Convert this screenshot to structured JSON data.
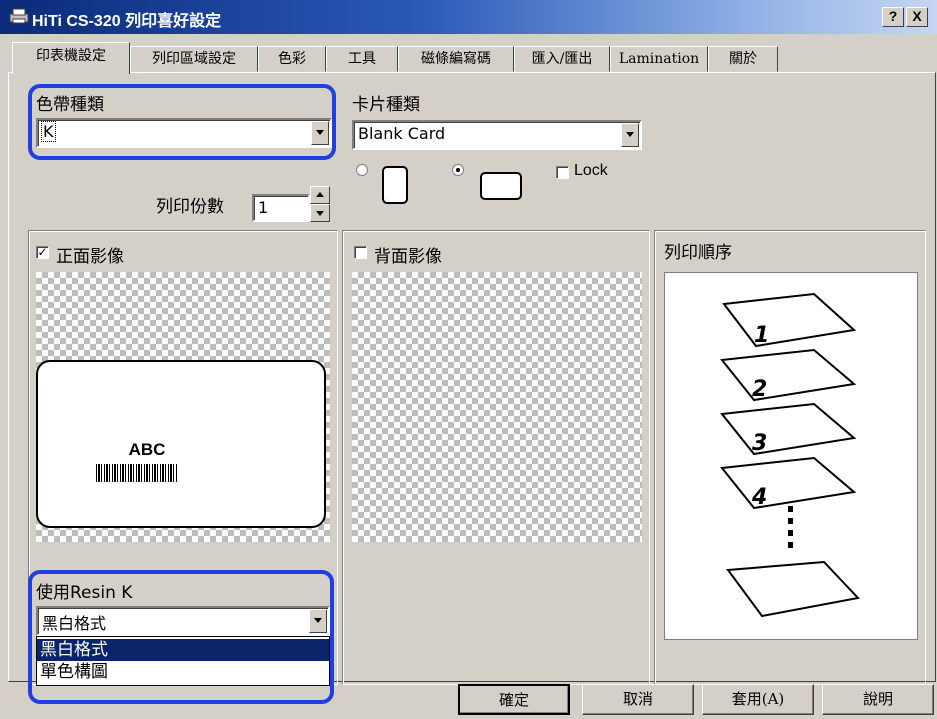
{
  "window": {
    "title": "HiTi CS-320 列印喜好設定",
    "help_btn": "?",
    "close_btn": "X"
  },
  "tabs": [
    {
      "label": "印表機設定",
      "active": true
    },
    {
      "label": "列印區域設定"
    },
    {
      "label": "色彩"
    },
    {
      "label": "工具"
    },
    {
      "label": "磁條編寫碼"
    },
    {
      "label": "匯入/匯出"
    },
    {
      "label": "Lamination"
    },
    {
      "label": "關於"
    }
  ],
  "ribbon": {
    "label": "色帶種類",
    "value": "K"
  },
  "copies": {
    "label": "列印份數",
    "value": "1"
  },
  "card": {
    "label": "卡片種類",
    "value": "Blank Card",
    "orientation_selected": "landscape",
    "lock_label": "Lock",
    "lock_checked": false
  },
  "front": {
    "label": "正面影像",
    "checked": true,
    "card_text": "ABC"
  },
  "back": {
    "label": "背面影像",
    "checked": false
  },
  "print_order": {
    "label": "列印順序",
    "sheets": [
      "1",
      "2",
      "3",
      "4"
    ]
  },
  "resin": {
    "label": "使用Resin K",
    "value": "黑白格式",
    "options": [
      "黑白格式",
      "單色構圖"
    ],
    "highlighted_index": 0
  },
  "buttons": {
    "ok": "確定",
    "cancel": "取消",
    "apply": "套用(A)",
    "help": "說明"
  },
  "colors": {
    "highlight_box": "#1f3fe0",
    "selection": "#0a246a",
    "face": "#d4d0c8"
  }
}
